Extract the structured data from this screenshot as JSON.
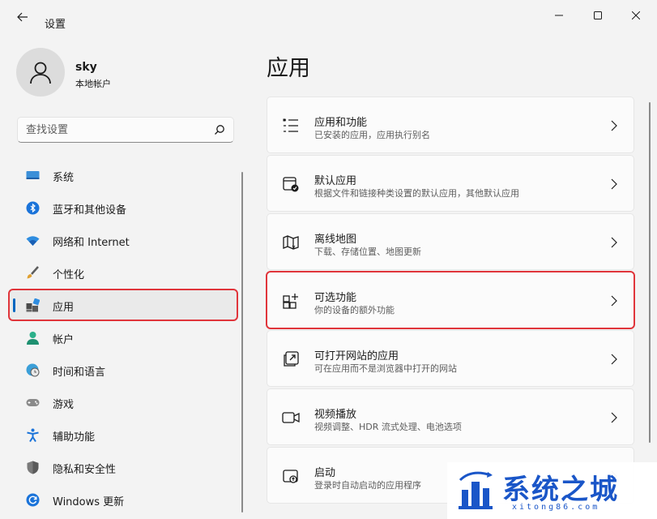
{
  "window": {
    "title": "设置"
  },
  "profile": {
    "name": "sky",
    "account_type": "本地帐户"
  },
  "search": {
    "placeholder": "查找设置"
  },
  "sidebar": {
    "items": [
      {
        "label": "系统",
        "icon": "monitor-icon"
      },
      {
        "label": "蓝牙和其他设备",
        "icon": "bluetooth-icon"
      },
      {
        "label": "网络和 Internet",
        "icon": "wifi-icon"
      },
      {
        "label": "个性化",
        "icon": "brush-icon"
      },
      {
        "label": "应用",
        "icon": "apps-icon",
        "active": true
      },
      {
        "label": "帐户",
        "icon": "person-icon"
      },
      {
        "label": "时间和语言",
        "icon": "globe-clock-icon"
      },
      {
        "label": "游戏",
        "icon": "gamepad-icon"
      },
      {
        "label": "辅助功能",
        "icon": "accessibility-icon"
      },
      {
        "label": "隐私和安全性",
        "icon": "shield-icon"
      },
      {
        "label": "Windows 更新",
        "icon": "update-icon"
      }
    ]
  },
  "main": {
    "title": "应用",
    "cards": [
      {
        "title": "应用和功能",
        "subtitle": "已安装的应用，应用执行别名",
        "icon": "list-icon"
      },
      {
        "title": "默认应用",
        "subtitle": "根据文件和链接种类设置的默认应用，其他默认应用",
        "icon": "default-app-icon"
      },
      {
        "title": "离线地图",
        "subtitle": "下载、存储位置、地图更新",
        "icon": "map-icon"
      },
      {
        "title": "可选功能",
        "subtitle": "你的设备的额外功能",
        "icon": "add-feature-icon",
        "highlighted": true
      },
      {
        "title": "可打开网站的应用",
        "subtitle": "可在应用而不是浏览器中打开的网站",
        "icon": "open-link-icon"
      },
      {
        "title": "视频播放",
        "subtitle": "视频调整、HDR 流式处理、电池选项",
        "icon": "video-icon"
      },
      {
        "title": "启动",
        "subtitle": "登录时自动启动的应用程序",
        "icon": "startup-icon"
      }
    ]
  },
  "watermark": {
    "text": "系统之城",
    "url": "xitong86.com"
  },
  "colors": {
    "accent": "#0067c0",
    "highlight": "#e0353b",
    "watermark": "#1a56c8"
  }
}
